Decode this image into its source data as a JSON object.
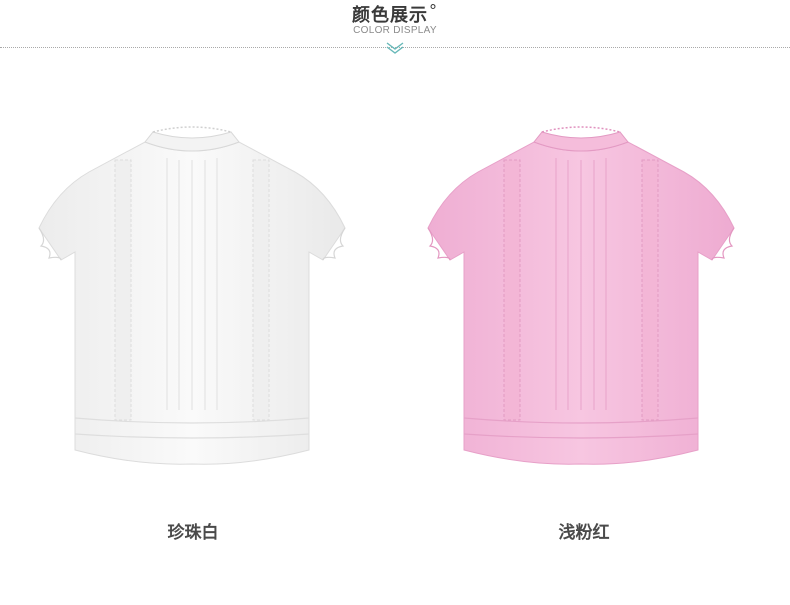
{
  "header": {
    "title": "颜色展示",
    "degree_mark": "°",
    "subtitle": "COLOR DISPLAY",
    "chevron_icon": "double-chevron-down-icon"
  },
  "products": [
    {
      "name": "珍珠白",
      "color": "#f7f7f7"
    },
    {
      "name": "浅粉红",
      "color": "#f4b9da"
    }
  ],
  "colors": {
    "accent_chevron": "#66b8b8",
    "title_text": "#3a3a3a",
    "label_text": "#4a4a4a"
  }
}
